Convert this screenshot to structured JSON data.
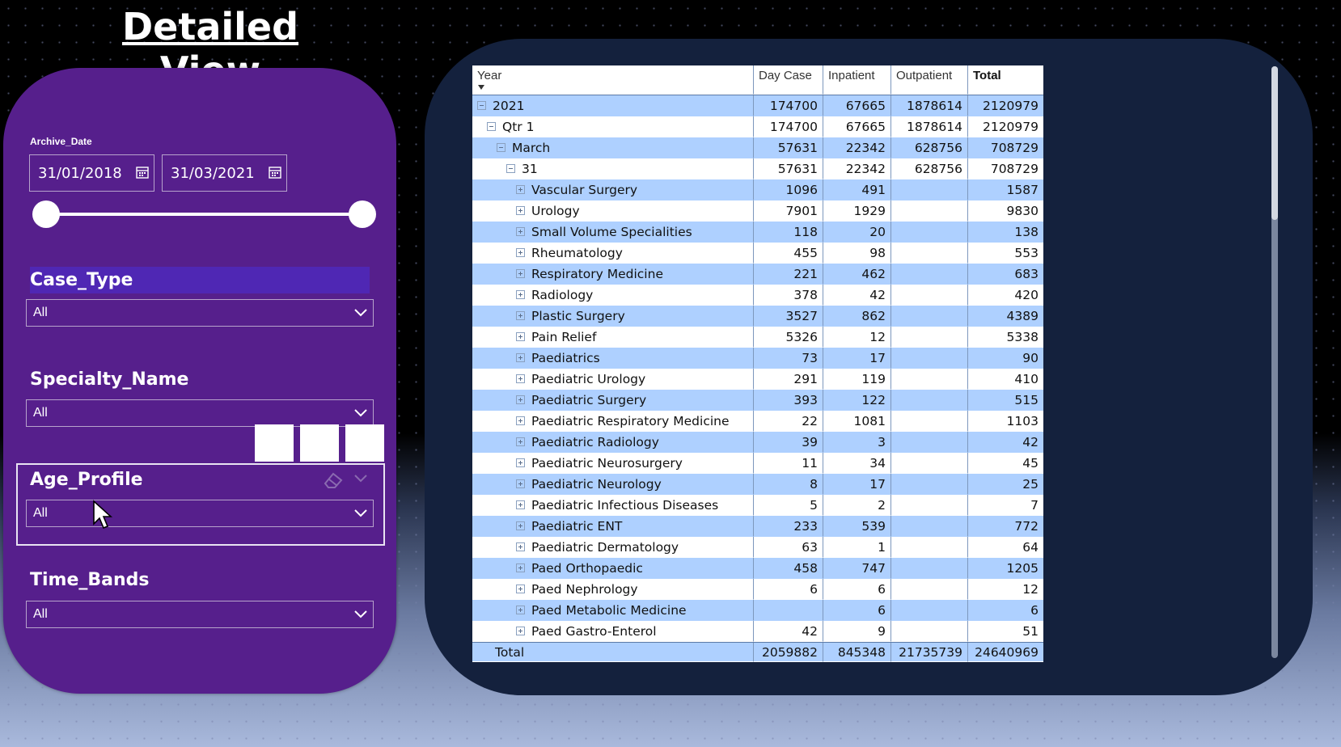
{
  "page": {
    "title": "Detailed View"
  },
  "filters": {
    "archive_date": {
      "label": "Archive_Date",
      "start": "31/01/2018",
      "end": "31/03/2021"
    },
    "case_type": {
      "label": "Case_Type",
      "value": "All"
    },
    "specialty_name": {
      "label": "Specialty_Name",
      "value": "All"
    },
    "age_profile": {
      "label": "Age_Profile",
      "value": "All"
    },
    "time_bands": {
      "label": "Time_Bands",
      "value": "All"
    }
  },
  "matrix": {
    "columns": [
      "Year",
      "Day Case",
      "Inpatient",
      "Outpatient",
      "Total"
    ],
    "rows": [
      {
        "level": 0,
        "toggle": "minus",
        "label": "2021",
        "day_case": "174700",
        "inpatient": "67665",
        "outpatient": "1878614",
        "total": "2120979"
      },
      {
        "level": 1,
        "toggle": "minus",
        "label": "Qtr 1",
        "day_case": "174700",
        "inpatient": "67665",
        "outpatient": "1878614",
        "total": "2120979"
      },
      {
        "level": 2,
        "toggle": "minus",
        "label": "March",
        "day_case": "57631",
        "inpatient": "22342",
        "outpatient": "628756",
        "total": "708729"
      },
      {
        "level": 3,
        "toggle": "minus",
        "label": "31",
        "day_case": "57631",
        "inpatient": "22342",
        "outpatient": "628756",
        "total": "708729"
      },
      {
        "level": 4,
        "toggle": "plus",
        "label": "Vascular Surgery",
        "day_case": "1096",
        "inpatient": "491",
        "outpatient": "",
        "total": "1587"
      },
      {
        "level": 4,
        "toggle": "plus",
        "label": "Urology",
        "day_case": "7901",
        "inpatient": "1929",
        "outpatient": "",
        "total": "9830"
      },
      {
        "level": 4,
        "toggle": "plus",
        "label": "Small Volume Specialities",
        "day_case": "118",
        "inpatient": "20",
        "outpatient": "",
        "total": "138"
      },
      {
        "level": 4,
        "toggle": "plus",
        "label": "Rheumatology",
        "day_case": "455",
        "inpatient": "98",
        "outpatient": "",
        "total": "553"
      },
      {
        "level": 4,
        "toggle": "plus",
        "label": "Respiratory Medicine",
        "day_case": "221",
        "inpatient": "462",
        "outpatient": "",
        "total": "683"
      },
      {
        "level": 4,
        "toggle": "plus",
        "label": "Radiology",
        "day_case": "378",
        "inpatient": "42",
        "outpatient": "",
        "total": "420"
      },
      {
        "level": 4,
        "toggle": "plus",
        "label": "Plastic Surgery",
        "day_case": "3527",
        "inpatient": "862",
        "outpatient": "",
        "total": "4389"
      },
      {
        "level": 4,
        "toggle": "plus",
        "label": "Pain Relief",
        "day_case": "5326",
        "inpatient": "12",
        "outpatient": "",
        "total": "5338"
      },
      {
        "level": 4,
        "toggle": "plus",
        "label": "Paediatrics",
        "day_case": "73",
        "inpatient": "17",
        "outpatient": "",
        "total": "90"
      },
      {
        "level": 4,
        "toggle": "plus",
        "label": "Paediatric Urology",
        "day_case": "291",
        "inpatient": "119",
        "outpatient": "",
        "total": "410"
      },
      {
        "level": 4,
        "toggle": "plus",
        "label": "Paediatric Surgery",
        "day_case": "393",
        "inpatient": "122",
        "outpatient": "",
        "total": "515"
      },
      {
        "level": 4,
        "toggle": "plus",
        "label": "Paediatric Respiratory Medicine",
        "day_case": "22",
        "inpatient": "1081",
        "outpatient": "",
        "total": "1103"
      },
      {
        "level": 4,
        "toggle": "plus",
        "label": "Paediatric Radiology",
        "day_case": "39",
        "inpatient": "3",
        "outpatient": "",
        "total": "42"
      },
      {
        "level": 4,
        "toggle": "plus",
        "label": "Paediatric Neurosurgery",
        "day_case": "11",
        "inpatient": "34",
        "outpatient": "",
        "total": "45"
      },
      {
        "level": 4,
        "toggle": "plus",
        "label": "Paediatric Neurology",
        "day_case": "8",
        "inpatient": "17",
        "outpatient": "",
        "total": "25"
      },
      {
        "level": 4,
        "toggle": "plus",
        "label": "Paediatric Infectious Diseases",
        "day_case": "5",
        "inpatient": "2",
        "outpatient": "",
        "total": "7"
      },
      {
        "level": 4,
        "toggle": "plus",
        "label": "Paediatric ENT",
        "day_case": "233",
        "inpatient": "539",
        "outpatient": "",
        "total": "772"
      },
      {
        "level": 4,
        "toggle": "plus",
        "label": "Paediatric Dermatology",
        "day_case": "63",
        "inpatient": "1",
        "outpatient": "",
        "total": "64"
      },
      {
        "level": 4,
        "toggle": "plus",
        "label": "Paed Orthopaedic",
        "day_case": "458",
        "inpatient": "747",
        "outpatient": "",
        "total": "1205"
      },
      {
        "level": 4,
        "toggle": "plus",
        "label": "Paed Nephrology",
        "day_case": "6",
        "inpatient": "6",
        "outpatient": "",
        "total": "12"
      },
      {
        "level": 4,
        "toggle": "plus",
        "label": "Paed Metabolic Medicine",
        "day_case": "",
        "inpatient": "6",
        "outpatient": "",
        "total": "6"
      },
      {
        "level": 4,
        "toggle": "plus",
        "label": "Paed Gastro-Enterol",
        "day_case": "42",
        "inpatient": "9",
        "outpatient": "",
        "total": "51"
      }
    ],
    "total_row": {
      "label": "Total",
      "day_case": "2059882",
      "inpatient": "845348",
      "outpatient": "21735739",
      "total": "24640969"
    }
  },
  "colors": {
    "filter_pane": "#561f8c",
    "table_pane": "#14213d",
    "row_band": "#aed0ff",
    "selected_title": "#4f27b4"
  }
}
